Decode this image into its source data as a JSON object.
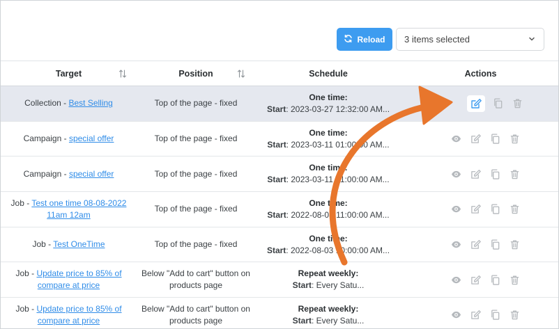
{
  "toolbar": {
    "reload_label": "Reload",
    "selection_label": "3 items selected"
  },
  "table": {
    "headers": {
      "target": "Target",
      "position": "Position",
      "schedule": "Schedule",
      "actions": "Actions"
    },
    "rows": [
      {
        "target_prefix": "Collection - ",
        "target_link": "Best Selling",
        "position": "Top of the page - fixed",
        "schedule_type": "One time:",
        "start_label": "Start",
        "start_value": ": 2023-03-27 12:32:00 AM...",
        "selected": true
      },
      {
        "target_prefix": "Campaign - ",
        "target_link": "special offer",
        "position": "Top of the page - fixed",
        "schedule_type": "One time:",
        "start_label": "Start",
        "start_value": ": 2023-03-11 01:00:00 AM..."
      },
      {
        "target_prefix": "Campaign - ",
        "target_link": "special offer",
        "position": "Top of the page - fixed",
        "schedule_type": "One time:",
        "start_label": "Start",
        "start_value": ": 2023-03-11 01:00:00 AM..."
      },
      {
        "target_prefix": "Job - ",
        "target_link": "Test one time 08-08-2022 11am 12am",
        "position": "Top of the page - fixed",
        "schedule_type": "One time:",
        "start_label": "Start",
        "start_value": ": 2022-08-08 11:00:00 AM..."
      },
      {
        "target_prefix": "Job - ",
        "target_link": "Test OneTime",
        "position": "Top of the page - fixed",
        "schedule_type": "One time:",
        "start_label": "Start",
        "start_value": ": 2022-08-03 10:00:00 AM..."
      },
      {
        "target_prefix": "Job - ",
        "target_link": "Update price to 85% of compare at price",
        "position": "Below \"Add to cart\" button on products page",
        "schedule_type": "Repeat weekly:",
        "start_label": "Start",
        "start_value": ": Every Satu..."
      },
      {
        "target_prefix": "Job - ",
        "target_link": "Update price to 85% of compare at price",
        "position": "Below \"Add to cart\" button on products page",
        "schedule_type": "Repeat weekly:",
        "start_label": "Start",
        "start_value": ": Every Satu..."
      }
    ]
  },
  "colors": {
    "primary": "#3d9cf0",
    "link": "#2f8ce8",
    "selected_row": "#e5e8ef",
    "annotation_arrow": "#e8762c",
    "icon": "#b5b9bd"
  },
  "icons": [
    "refresh-icon",
    "chevron-down-icon",
    "sort-icon",
    "eye-icon",
    "edit-icon",
    "copy-icon",
    "trash-icon"
  ]
}
